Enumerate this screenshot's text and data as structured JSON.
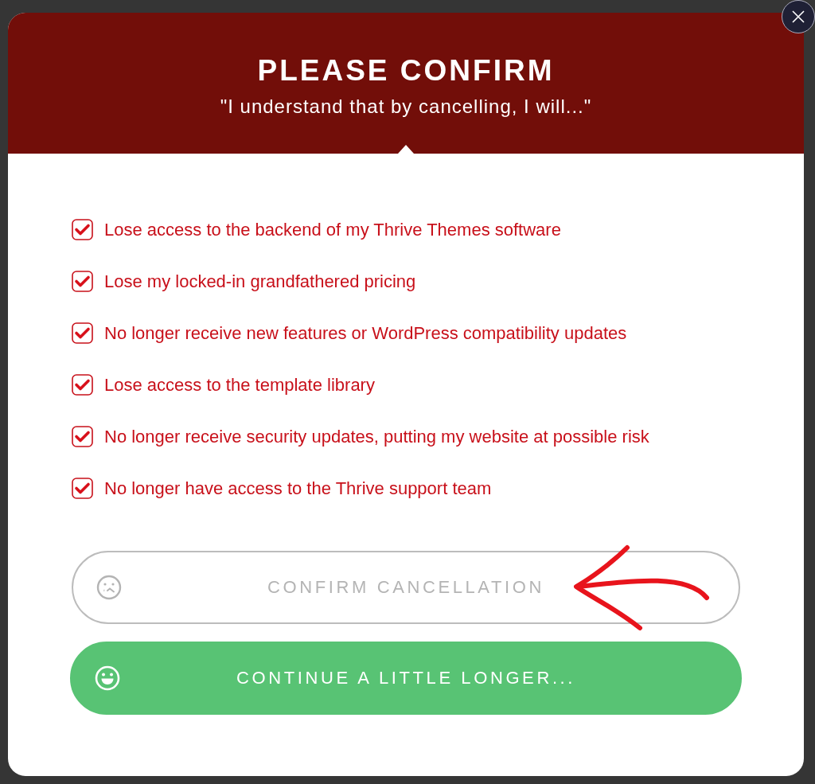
{
  "dialog": {
    "title": "PLEASE CONFIRM",
    "subtitle": "\"I understand that by cancelling, I will...\""
  },
  "checklist": [
    {
      "label": "Lose access to the backend of my Thrive Themes software",
      "checked": true
    },
    {
      "label": "Lose my locked-in grandfathered pricing",
      "checked": true
    },
    {
      "label": "No longer receive new features or WordPress compatibility updates",
      "checked": true
    },
    {
      "label": "Lose access to the template library",
      "checked": true
    },
    {
      "label": "No longer receive security updates, putting my website at possible risk",
      "checked": true
    },
    {
      "label": "No longer have access to the Thrive support team",
      "checked": true
    }
  ],
  "buttons": [
    {
      "kind": "outline",
      "label": "CONFIRM CANCELLATION"
    },
    {
      "kind": "primary",
      "label": "CONTINUE A LITTLE LONGER..."
    }
  ]
}
